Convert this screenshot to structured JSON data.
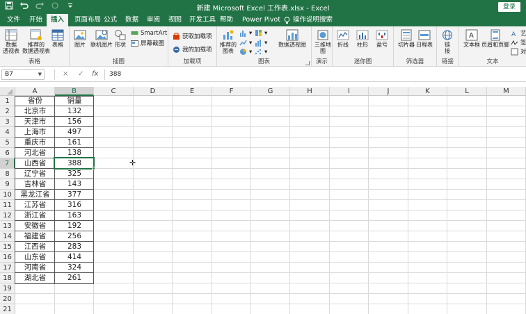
{
  "titlebar": {
    "title": "新建 Microsoft Excel 工作表.xlsx  -  Excel",
    "login_label": "登录",
    "qa_icons": [
      "save-icon",
      "undo-icon",
      "redo-icon",
      "touch-mode-icon",
      "customize-icon"
    ],
    "bg_color": "#217346"
  },
  "tabs": [
    {
      "label": "文件"
    },
    {
      "label": "开始"
    },
    {
      "label": "插入",
      "active": true
    },
    {
      "label": "页面布局"
    },
    {
      "label": "公式"
    },
    {
      "label": "数据"
    },
    {
      "label": "审阅"
    },
    {
      "label": "视图"
    },
    {
      "label": "开发工具"
    },
    {
      "label": "帮助"
    },
    {
      "label": "Power Pivot"
    }
  ],
  "tell_me": "操作说明搜索",
  "ribbon": {
    "groups": {
      "tables": {
        "label": "表格",
        "buttons": [
          "数据\n透视表",
          "推荐的\n数据透视表",
          "表格"
        ]
      },
      "illustrations": {
        "label": "插图",
        "buttons": [
          "图片",
          "联机图片",
          "形状"
        ],
        "small": [
          "SmartArt",
          "屏幕截图"
        ]
      },
      "addins": {
        "label": "加载项",
        "small": [
          "获取加载项",
          "我的加载项"
        ]
      },
      "charts": {
        "label": "图表",
        "buttons": [
          "推荐的\n图表",
          "数据透视图"
        ]
      },
      "tours": {
        "label": "演示",
        "buttons": [
          "三维地\n图"
        ]
      },
      "sparklines": {
        "label": "迷你图",
        "buttons": [
          "折线",
          "柱形",
          "盈亏"
        ]
      },
      "filters": {
        "label": "筛选器",
        "buttons": [
          "切片器",
          "日程表"
        ]
      },
      "links": {
        "label": "链接",
        "buttons": [
          "链\n接"
        ]
      },
      "text": {
        "label": "文本",
        "buttons": [
          "文本框",
          "页眉和页脚"
        ],
        "small": [
          "艺术",
          "签名",
          "对象"
        ]
      }
    }
  },
  "formula_bar": {
    "name_box": "B7",
    "cancel": "×",
    "enter": "✓",
    "fx": "fx",
    "value": "388"
  },
  "columns": [
    "A",
    "B",
    "C",
    "D",
    "E",
    "F",
    "G",
    "H",
    "I",
    "J",
    "K",
    "L",
    "M"
  ],
  "rows": [
    "1",
    "2",
    "3",
    "4",
    "5",
    "6",
    "7",
    "8",
    "9",
    "10",
    "11",
    "12",
    "13",
    "14",
    "15",
    "16",
    "17",
    "18",
    "19",
    "20",
    "21"
  ],
  "table": {
    "headers": [
      "省份",
      "销量"
    ],
    "rows": [
      [
        "北京市",
        "132"
      ],
      [
        "天津市",
        "156"
      ],
      [
        "上海市",
        "497"
      ],
      [
        "重庆市",
        "161"
      ],
      [
        "河北省",
        "138"
      ],
      [
        "山西省",
        "388"
      ],
      [
        "辽宁省",
        "325"
      ],
      [
        "吉林省",
        "143"
      ],
      [
        "黑龙江省",
        "377"
      ],
      [
        "江苏省",
        "316"
      ],
      [
        "浙江省",
        "163"
      ],
      [
        "安徽省",
        "192"
      ],
      [
        "福建省",
        "256"
      ],
      [
        "江西省",
        "283"
      ],
      [
        "山东省",
        "414"
      ],
      [
        "河南省",
        "324"
      ],
      [
        "湖北省",
        "261"
      ]
    ]
  },
  "selection": {
    "cell": "B7",
    "column": "B",
    "row": "7"
  },
  "accent_color": "#217346"
}
